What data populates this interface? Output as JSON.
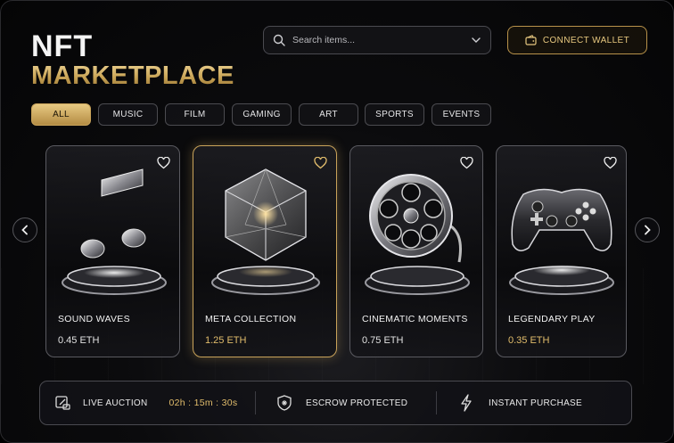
{
  "header": {
    "title_line1": "NFT",
    "title_line2": "MARKETPLACE"
  },
  "search": {
    "placeholder": "Search items...",
    "icon": "search-icon",
    "dropdown_icon": "chevron-down-icon"
  },
  "wallet_button": {
    "label": "CONNECT WALLET",
    "icon": "wallet-icon"
  },
  "tabs": [
    {
      "label": "ALL",
      "active": true
    },
    {
      "label": "MUSIC",
      "active": false
    },
    {
      "label": "FILM",
      "active": false
    },
    {
      "label": "GAMING",
      "active": false
    },
    {
      "label": "ART",
      "active": false
    },
    {
      "label": "SPORTS",
      "active": false
    },
    {
      "label": "EVENTS",
      "active": false
    }
  ],
  "cards": [
    {
      "name": "SOUND WAVES",
      "price": "0.45 ETH",
      "icon": "music-note-icon",
      "featured": false
    },
    {
      "name": "META COLLECTION",
      "price": "1.25 ETH",
      "icon": "crystal-cube-icon",
      "featured": true
    },
    {
      "name": "CINEMATIC MOMENTS",
      "price": "0.75 ETH",
      "icon": "film-reel-icon",
      "featured": false
    },
    {
      "name": "LEGENDARY PLAY",
      "price": "0.35 ETH",
      "icon": "gamepad-icon",
      "featured": false
    }
  ],
  "carousel": {
    "prev_icon": "chevron-left-icon",
    "next_icon": "chevron-right-icon"
  },
  "info_bar": {
    "auction_label": "LIVE AUCTION",
    "auction_timer": "02h : 15m : 30s",
    "escrow_label": "ESCROW PROTECTED",
    "instant_label": "INSTANT PURCHASE"
  },
  "colors": {
    "accent_gold": "#e2bd6c",
    "background": "#050506",
    "border": "#5a5a60"
  }
}
